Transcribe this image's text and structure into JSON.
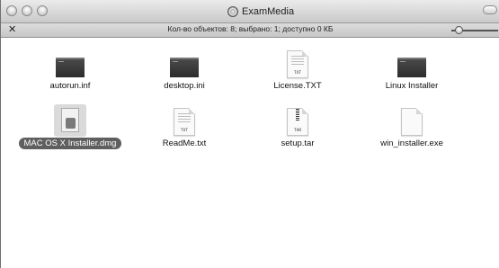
{
  "window": {
    "title": "ExamMedia",
    "status_text": "Кол-во объектов: 8; выбрано: 1; доступно 0 КБ"
  },
  "icons": {
    "title_icon": "cd-disc-icon",
    "pin": "pin-icon",
    "zoom": "zoom-slider"
  },
  "files": [
    {
      "name": "autorun.inf",
      "kind": "dark",
      "selected": false
    },
    {
      "name": "desktop.ini",
      "kind": "dark",
      "selected": false
    },
    {
      "name": "License.TXT",
      "kind": "txt",
      "ext": "TXT",
      "selected": false
    },
    {
      "name": "Linux Installer",
      "kind": "dark",
      "selected": false
    },
    {
      "name": "MAC OS X Installer.dmg",
      "kind": "dmg",
      "selected": true
    },
    {
      "name": "ReadMe.txt",
      "kind": "txt",
      "ext": "TXT",
      "selected": false
    },
    {
      "name": "setup.tar",
      "kind": "tar",
      "ext": "TAR",
      "selected": false
    },
    {
      "name": "win_installer.exe",
      "kind": "blank",
      "selected": false
    }
  ],
  "colors": {
    "selection": "#5f5f5f",
    "titlebar_top": "#ebebeb",
    "titlebar_bottom": "#c9c9c9"
  }
}
